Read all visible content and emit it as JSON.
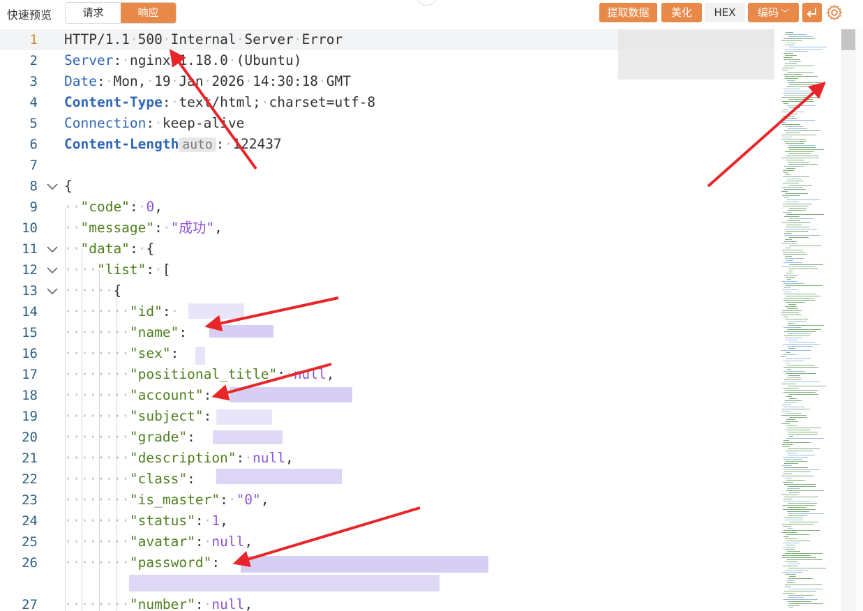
{
  "toolbar": {
    "title": "快速预览",
    "tab_request": "请求",
    "tab_response": "响应",
    "btn_extract": "提取数据",
    "btn_beautify": "美化",
    "btn_hex": "HEX",
    "btn_encoding": "编码",
    "accent": "#e8894a"
  },
  "lines": {
    "n1": "1",
    "n2": "2",
    "n3": "3",
    "n4": "4",
    "n5": "5",
    "n6": "6",
    "n7": "7",
    "n8": "8",
    "n9": "9",
    "n10": "10",
    "n11": "11",
    "n12": "12",
    "n13": "13",
    "n14": "14",
    "n15": "15",
    "n16": "16",
    "n17": "17",
    "n18": "18",
    "n19": "19",
    "n20": "20",
    "n21": "21",
    "n22": "22",
    "n23": "23",
    "n24": "24",
    "n25": "25",
    "n26": "26",
    "n27": "27"
  },
  "http": {
    "version": "HTTP/1.1",
    "status": "500",
    "w1": "Internal",
    "w2": "Server",
    "w3": "Error",
    "server_key": "Server",
    "server_v1": "nginx/1.18.0",
    "server_v2": "(Ubuntu)",
    "date_key": "Date",
    "date_v1": "Mon,",
    "date_v2": "19",
    "date_v3": "Jan",
    "date_v4": "2026",
    "date_v5": "14:30:18",
    "date_v6": "GMT",
    "ct_key": "Content-Type",
    "ct_v1": "text/html;",
    "ct_v2": "charset=utf-8",
    "conn_key": "Connection",
    "conn_val": "keep-alive",
    "cl_key": "Content-Length",
    "cl_badge": "auto",
    "cl_val": "122437"
  },
  "json": {
    "code_key": "\"code\"",
    "code_val": "0",
    "message_key": "\"message\"",
    "message_val": "\"成功\"",
    "data_key": "\"data\"",
    "list_key": "\"list\"",
    "id_key": "\"id\"",
    "name_key": "\"name\"",
    "sex_key": "\"sex\"",
    "pos_key": "\"positional_title\"",
    "null": "null",
    "account_key": "\"account\"",
    "subject_key": "\"subject\"",
    "grade_key": "\"grade\"",
    "desc_key": "\"description\"",
    "class_key": "\"class\"",
    "master_key": "\"is_master\"",
    "master_val": "\"0\"",
    "status_key": "\"status\"",
    "status_val": "1",
    "avatar_key": "\"avatar\"",
    "password_key": "\"password\"",
    "number_key": "\"number\""
  },
  "icons": {
    "gear": "gear-icon",
    "wrap": "wrap-icon",
    "fold": "chevron-down-icon"
  }
}
